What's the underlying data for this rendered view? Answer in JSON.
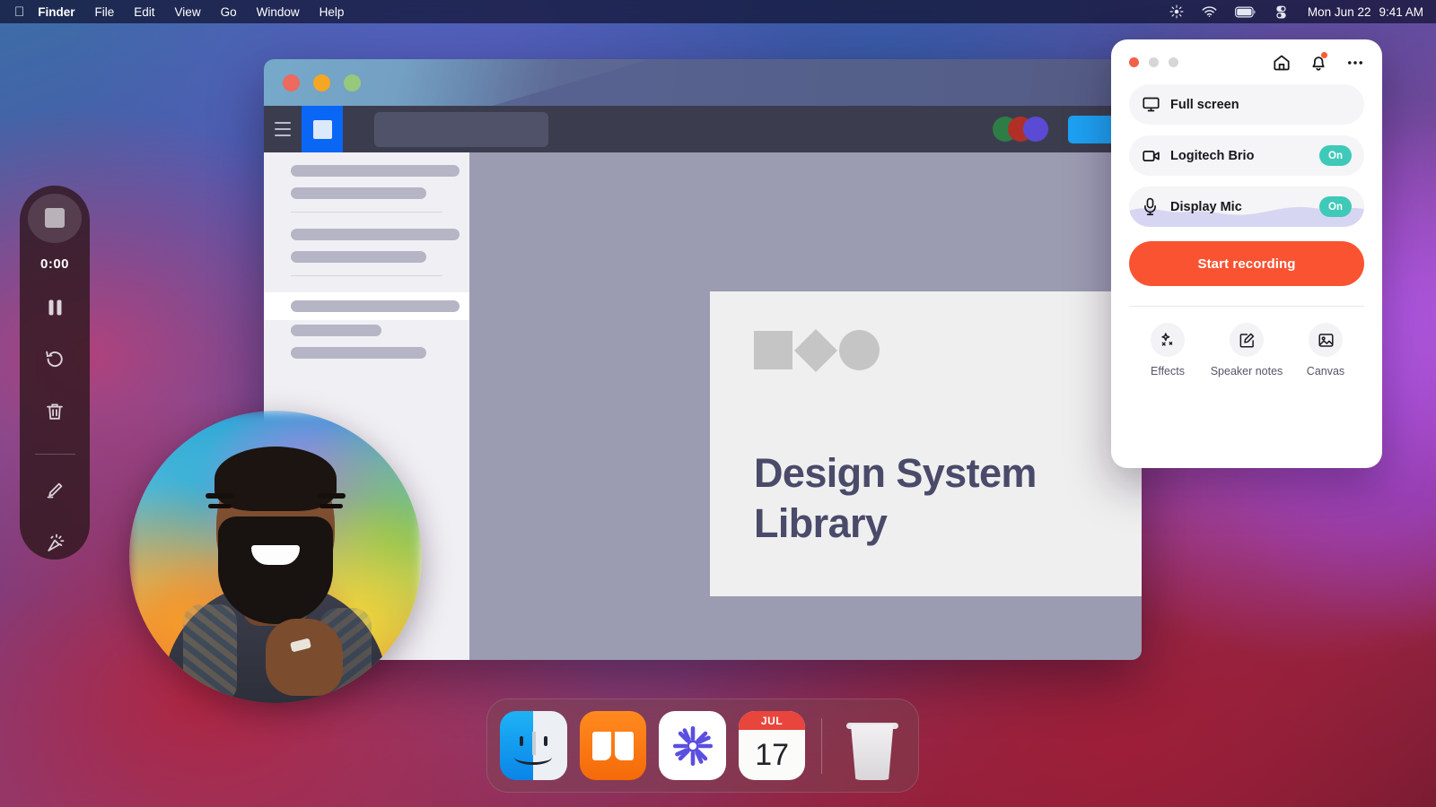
{
  "menubar": {
    "apple_glyph": "",
    "items": [
      {
        "label": "Finder",
        "bold": true
      },
      {
        "label": "File",
        "bold": false
      },
      {
        "label": "Edit",
        "bold": false
      },
      {
        "label": "View",
        "bold": false
      },
      {
        "label": "Go",
        "bold": false
      },
      {
        "label": "Window",
        "bold": false
      },
      {
        "label": "Help",
        "bold": false
      }
    ],
    "status_icons": [
      "brightness-icon",
      "wifi-icon",
      "battery-icon",
      "control-center-icon"
    ],
    "date": "Mon Jun 22",
    "time": "9:41 AM"
  },
  "app_window": {
    "traffic_lights": [
      "close",
      "minimize",
      "zoom"
    ],
    "toolbar": {
      "menu_icon": "hamburger-icon",
      "logo_icon": "app-logo-icon",
      "search_placeholder": "",
      "avatar_colors": [
        "#2e7d46",
        "#b03028",
        "#5b4ad4"
      ],
      "cta_color": "#1da1f2"
    },
    "sidebar": {
      "groups": [
        {
          "rows": [
            "w1",
            "w2"
          ]
        },
        {
          "rows": [
            "w1",
            "w2"
          ]
        },
        {
          "rows": [
            "w1"
          ],
          "selected": true
        },
        {
          "rows": [
            "w3",
            "w2"
          ]
        }
      ]
    },
    "document": {
      "shapes": [
        "square",
        "diamond",
        "circle"
      ],
      "title": "Design System Library"
    }
  },
  "recorder_toolbar": {
    "stop_label": "stop-recording",
    "timer": "0:00",
    "tools": [
      {
        "name": "pause-icon"
      },
      {
        "name": "restart-icon"
      },
      {
        "name": "trash-icon"
      },
      {
        "name": "pen-icon"
      },
      {
        "name": "magic-wand-icon"
      }
    ]
  },
  "webcam": {
    "label": "camera-bubble"
  },
  "panel": {
    "traffic_lights": [
      "close",
      "minimize",
      "zoom"
    ],
    "header_actions": [
      {
        "name": "home-icon",
        "badge": false
      },
      {
        "name": "bell-icon",
        "badge": true
      },
      {
        "name": "more-options-icon",
        "badge": false
      }
    ],
    "rows": [
      {
        "icon": "display-icon",
        "label": "Full screen",
        "toggle": null
      },
      {
        "icon": "camera-icon",
        "label": "Logitech Brio",
        "toggle": "On"
      },
      {
        "icon": "microphone-icon",
        "label": "Display Mic",
        "toggle": "On"
      }
    ],
    "start_button": "Start recording",
    "start_button_color": "#f95332",
    "toggle_on_color": "#3fc9b8",
    "actions": [
      {
        "icon": "effects-icon",
        "label": "Effects"
      },
      {
        "icon": "speaker-notes-icon",
        "label": "Speaker notes"
      },
      {
        "icon": "canvas-icon",
        "label": "Canvas"
      }
    ]
  },
  "dock": {
    "apps": [
      {
        "name": "finder",
        "running": false
      },
      {
        "name": "books",
        "running": false
      },
      {
        "name": "starburst-app",
        "running": true
      },
      {
        "name": "calendar",
        "running": false,
        "month": "JUL",
        "day": "17"
      }
    ],
    "trash": {
      "name": "trash",
      "label": "Trash"
    }
  }
}
